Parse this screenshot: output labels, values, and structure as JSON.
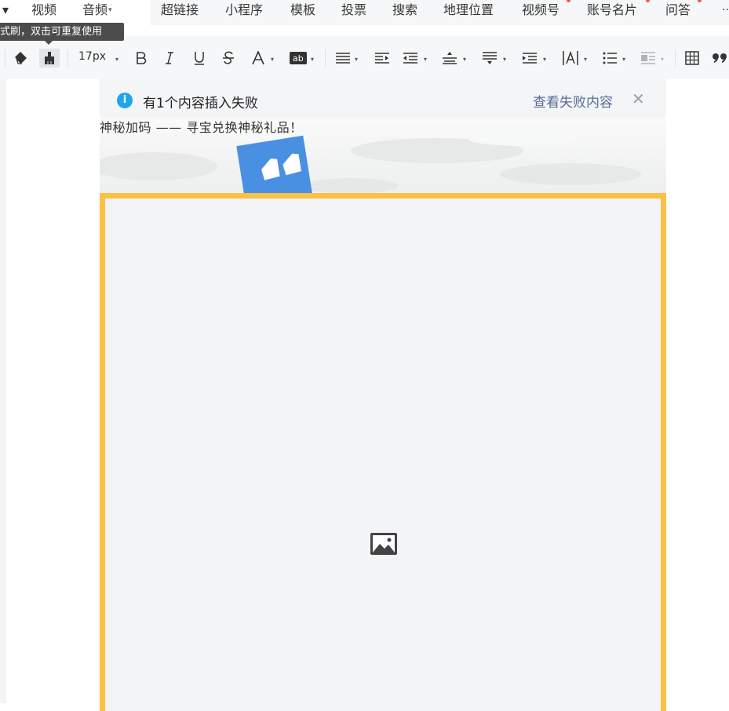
{
  "top_menu": {
    "left_caret": "▾",
    "video_label": "视频",
    "audio_label": "音频",
    "items": [
      "超链接",
      "小程序",
      "模板",
      "投票",
      "搜索",
      "地理位置",
      "视频号",
      "账号名片",
      "问答"
    ],
    "more": "··"
  },
  "tooltip": {
    "text": "式刷，双击可重复使用"
  },
  "toolbar": {
    "font_size": "17px"
  },
  "notice": {
    "message": "有1个内容插入失败",
    "link": "查看失败内容",
    "info_glyph": "i",
    "close_glyph": "✕"
  },
  "article": {
    "banner_text": "神秘加码 —— 寻宝兑换神秘礼品！"
  },
  "colors": {
    "accent_link": "#576b95",
    "info_blue": "#1fa4f0",
    "image_border": "#fbc144",
    "quote_card": "#4a90e2"
  }
}
